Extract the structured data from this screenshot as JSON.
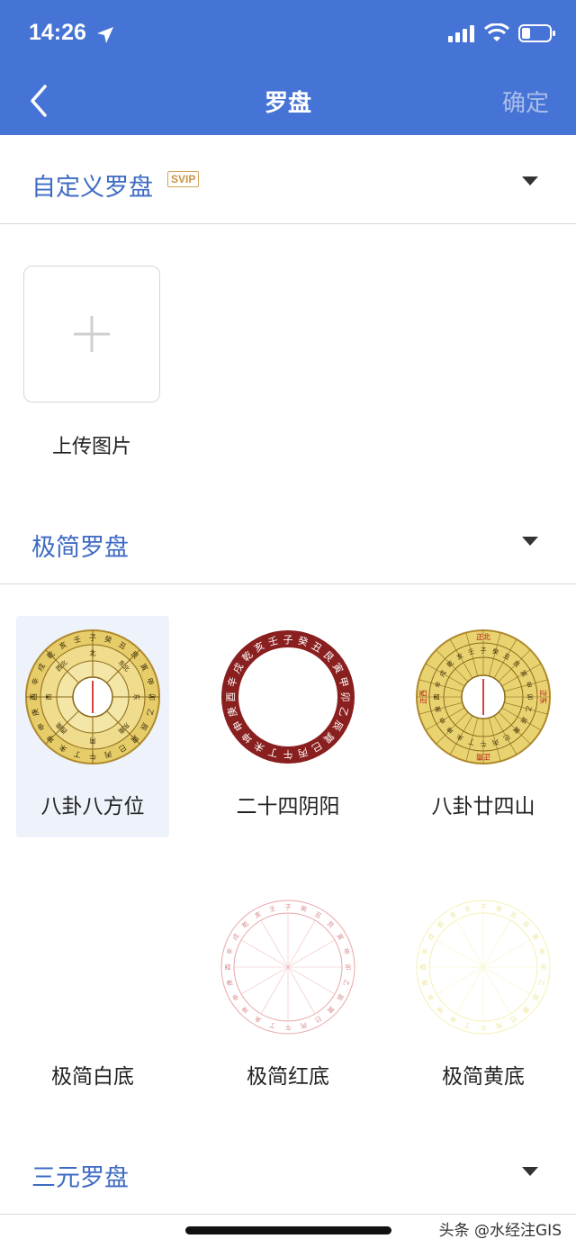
{
  "status_bar": {
    "time": "14:26"
  },
  "nav": {
    "title": "罗盘",
    "confirm": "确定"
  },
  "sections": {
    "custom": {
      "title": "自定义罗盘",
      "badge": "SVIP"
    },
    "minimal": {
      "title": "极简罗盘"
    },
    "sanyuan": {
      "title": "三元罗盘"
    }
  },
  "upload": {
    "label": "上传图片"
  },
  "tiles": [
    {
      "label": "八卦八方位",
      "selected": true
    },
    {
      "label": "二十四阴阳"
    },
    {
      "label": "八卦廿四山"
    },
    {
      "label": "极简白底"
    },
    {
      "label": "极简红底"
    },
    {
      "label": "极简黄底"
    }
  ],
  "compass_text": {
    "ring24": [
      "子",
      "癸",
      "丑",
      "艮",
      "寅",
      "甲",
      "卯",
      "乙",
      "辰",
      "巽",
      "巳",
      "丙",
      "午",
      "丁",
      "未",
      "坤",
      "申",
      "庚",
      "酉",
      "辛",
      "戌",
      "乾",
      "亥",
      "壬"
    ],
    "bagua_marks": [
      "北",
      "东北",
      "东",
      "东南",
      "南",
      "西南",
      "西",
      "西北"
    ],
    "main_marks": [
      "正北",
      "正东",
      "正南",
      "正西"
    ]
  },
  "footer": {
    "watermark": "头条 @水经注GIS"
  },
  "colors": {
    "header_bg": "#4673d6",
    "section_title": "#3f6bc4",
    "svip": "#c99445",
    "selected_tile": "#edf2fb"
  }
}
